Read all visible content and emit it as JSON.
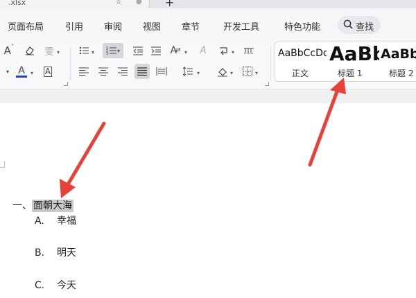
{
  "tab": {
    "title": ".xlsx"
  },
  "menu": {
    "items": [
      "页面布局",
      "引用",
      "审阅",
      "视图",
      "章节",
      "开发工具",
      "特色功能"
    ],
    "search_label": "查找"
  },
  "styles": {
    "items": [
      {
        "preview": "AaBbCcDd",
        "name": "正文"
      },
      {
        "preview": "AaBb",
        "name": "标题 1"
      },
      {
        "preview": "AaBb",
        "name": "标题 2"
      }
    ]
  },
  "document": {
    "heading": {
      "number": "一、",
      "text": "面朝大海"
    },
    "list": [
      {
        "marker": "A.",
        "text": "幸福"
      },
      {
        "marker": "B.",
        "text": "明天"
      },
      {
        "marker": "C.",
        "text": "今天"
      }
    ]
  },
  "colors": {
    "annotation_arrow": "#e8413a",
    "font_color_bar": "#2a3ccf",
    "highlight": "#c9c9c9"
  }
}
